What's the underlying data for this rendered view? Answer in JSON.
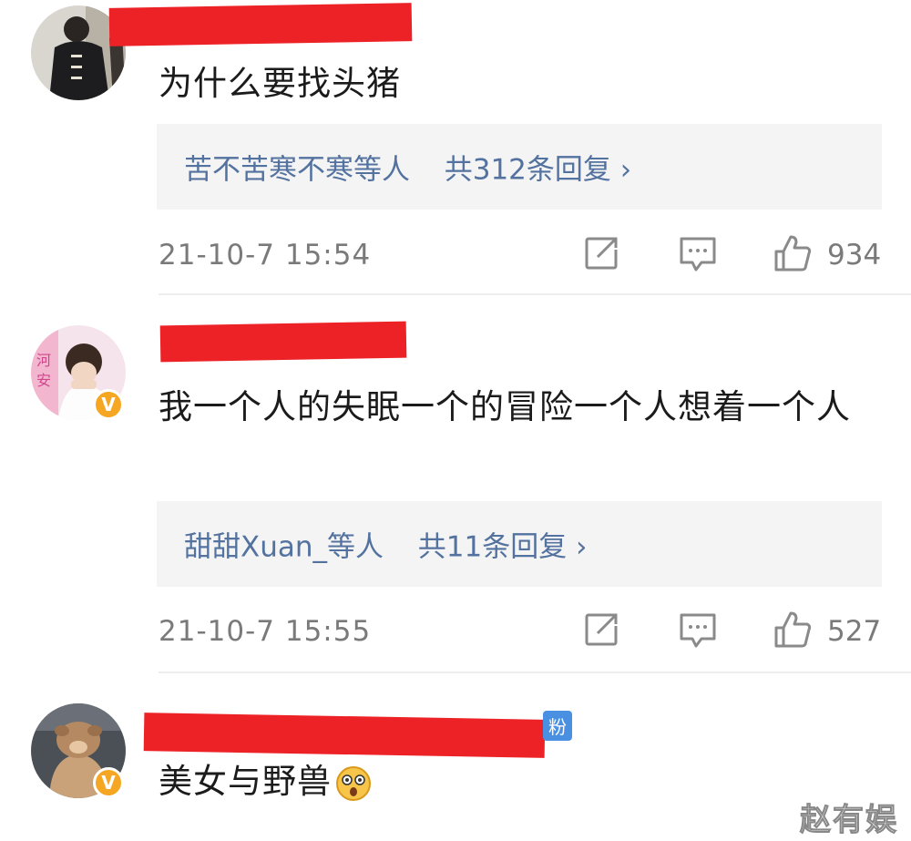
{
  "comments": [
    {
      "text": "为什么要找头猪",
      "replies_users": "苦不苦寒不寒等人",
      "replies_count": "共312条回复 ›",
      "time": "21-10-7 15:54",
      "likes": "934",
      "verified": false
    },
    {
      "text": "我一个人的失眠一个的冒险一个人想着一个人",
      "replies_users": "甜甜Xuan_等人",
      "replies_count": "共11条回复 ›",
      "time": "21-10-7 15:55",
      "likes": "527",
      "verified": true
    },
    {
      "text": "美女与野兽",
      "tag": "粉",
      "verified": true
    }
  ],
  "watermark": "赵有娱",
  "icons": [
    "share-icon",
    "comment-icon",
    "like-icon",
    "astonished-emoji-icon",
    "verified-v-icon"
  ],
  "colors": {
    "redaction": "#ec2227",
    "reply_link": "#53729f",
    "verified_badge": "#f5a623",
    "reply_box_bg": "#f4f4f4"
  }
}
